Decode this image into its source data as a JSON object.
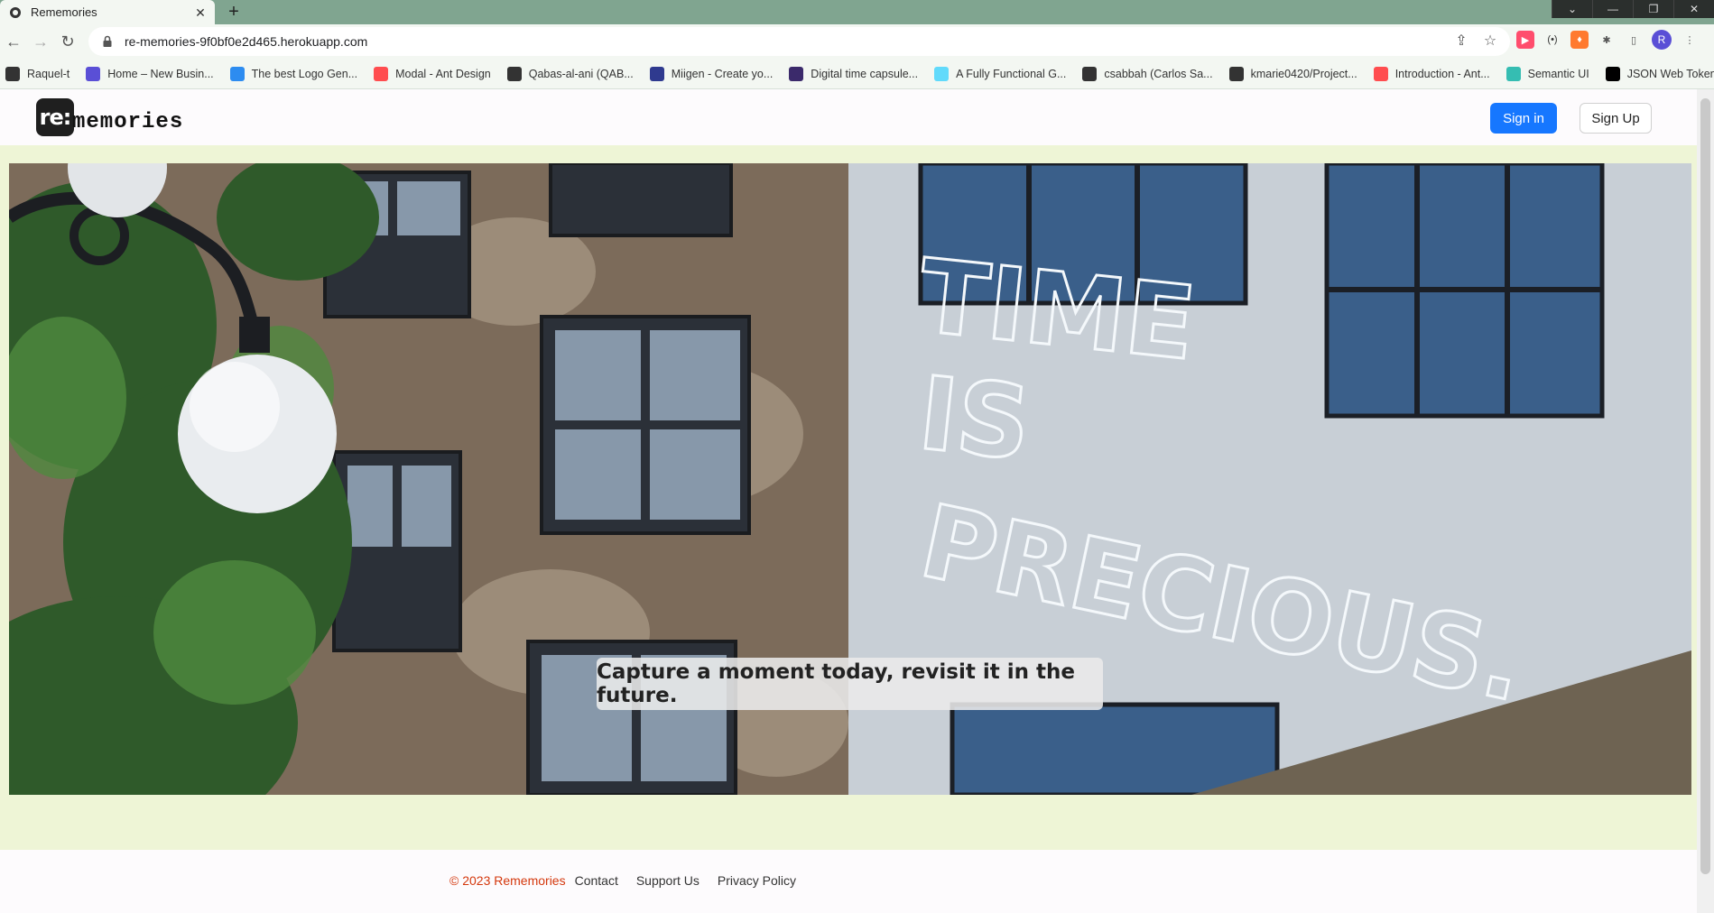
{
  "browser": {
    "tab_title": "Rememories",
    "url": "re-memories-9f0bf0e2d465.herokuapp.com",
    "profile_initial": "R",
    "bookmarks": [
      {
        "label": "Raquel-t",
        "icon": "github-icon",
        "color": "#333333"
      },
      {
        "label": "Home – New Busin...",
        "icon": "s-icon",
        "color": "#5a4fd6"
      },
      {
        "label": "The best Logo Gen...",
        "icon": "f-icon",
        "color": "#2d8cf0"
      },
      {
        "label": "Modal - Ant Design",
        "icon": "ant-icon",
        "color": "#ff4d4f"
      },
      {
        "label": "Qabas-al-ani (QAB...",
        "icon": "github-icon",
        "color": "#333333"
      },
      {
        "label": "Miigen - Create yo...",
        "icon": "m-icon",
        "color": "#2f3a8f"
      },
      {
        "label": "Digital time capsule...",
        "icon": "capsule-icon",
        "color": "#3b2a6b"
      },
      {
        "label": "A Fully Functional G...",
        "icon": "react-icon",
        "color": "#61dafb"
      },
      {
        "label": "csabbah (Carlos Sa...",
        "icon": "github-icon",
        "color": "#333333"
      },
      {
        "label": "kmarie0420/Project...",
        "icon": "github-icon",
        "color": "#333333"
      },
      {
        "label": "Introduction - Ant...",
        "icon": "ant-icon",
        "color": "#ff4d4f"
      },
      {
        "label": "Semantic UI",
        "icon": "s-icon",
        "color": "#35bdb2"
      },
      {
        "label": "JSON Web Tokens -...",
        "icon": "jwt-icon",
        "color": "#000000"
      }
    ]
  },
  "site": {
    "logo_badge": "re:",
    "logo_text": "memories",
    "signin_label": "Sign in",
    "signup_label": "Sign Up",
    "hero_caption": "Capture a moment today, revisit it in the future.",
    "neon_lines": [
      "TIME",
      "IS",
      "PRECIOUS."
    ]
  },
  "footer": {
    "copyright": "© 2023 Rememories",
    "links": [
      "Contact",
      "Support Us",
      "Privacy Policy"
    ]
  },
  "colors": {
    "primary": "#1677ff",
    "page_bg": "#eef5d6",
    "copyright": "#d4380d"
  }
}
